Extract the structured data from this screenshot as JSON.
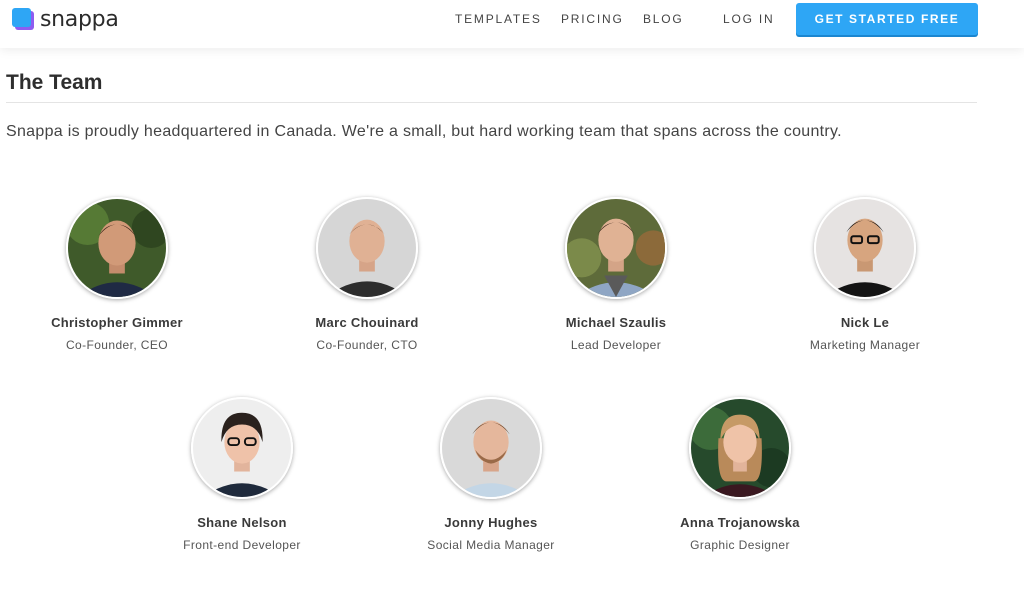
{
  "header": {
    "logo_text": "snappa",
    "nav": {
      "templates": "TEMPLATES",
      "pricing": "PRICING",
      "blog": "BLOG",
      "login": "LOG IN"
    },
    "cta_label": "GET STARTED FREE"
  },
  "colors": {
    "brand_blue": "#2ea6f5",
    "brand_purple": "#8e5cf0"
  },
  "page": {
    "title": "The Team",
    "intro": "Snappa is proudly headquartered in Canada. We're a small, but hard working team that spans across the country."
  },
  "team": [
    {
      "name": "Christopher Gimmer",
      "role": "Co-Founder, CEO"
    },
    {
      "name": "Marc Chouinard",
      "role": "Co-Founder, CTO"
    },
    {
      "name": "Michael Szaulis",
      "role": "Lead Developer"
    },
    {
      "name": "Nick Le",
      "role": "Marketing Manager"
    },
    {
      "name": "Shane Nelson",
      "role": "Front-end Developer"
    },
    {
      "name": "Jonny Hughes",
      "role": "Social Media Manager"
    },
    {
      "name": "Anna Trojanowska",
      "role": "Graphic Designer"
    }
  ]
}
